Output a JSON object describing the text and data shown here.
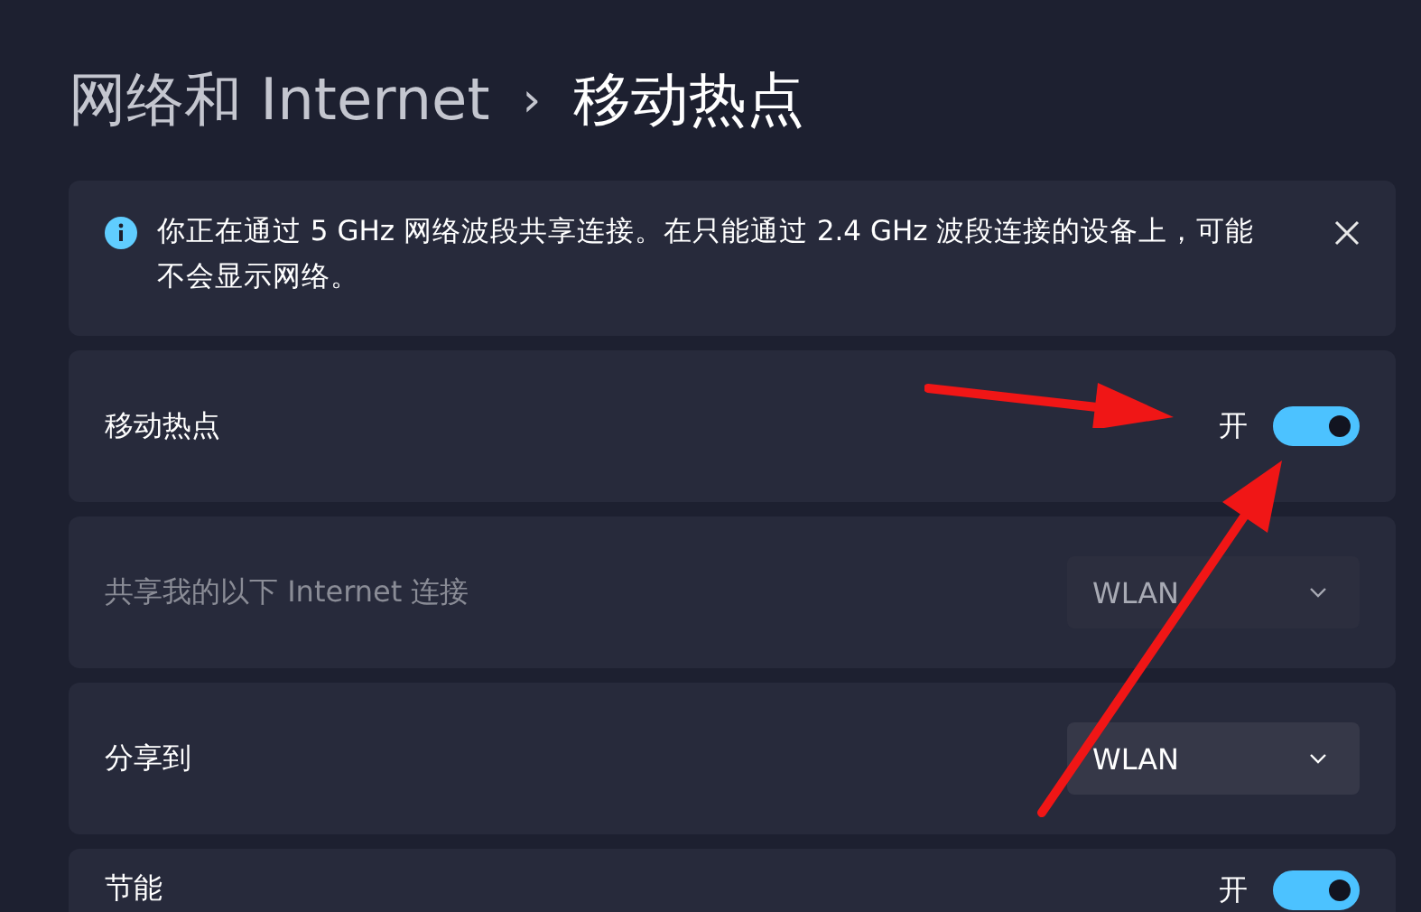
{
  "breadcrumb": {
    "parent": "网络和 Internet",
    "separator": "›",
    "current": "移动热点"
  },
  "info_banner": {
    "text": "你正在通过 5 GHz 网络波段共享连接。在只能通过 2.4 GHz 波段连接的设备上，可能不会显示网络。"
  },
  "settings": [
    {
      "kind": "toggle",
      "label": "移动热点",
      "state_text": "开",
      "on": true
    },
    {
      "kind": "dropdown",
      "label": "共享我的以下 Internet 连接",
      "value": "WLAN",
      "disabled": true
    },
    {
      "kind": "dropdown",
      "label": "分享到",
      "value": "WLAN",
      "disabled": false
    },
    {
      "kind": "toggle",
      "label": "节能",
      "state_text": "开",
      "on": true
    }
  ]
}
